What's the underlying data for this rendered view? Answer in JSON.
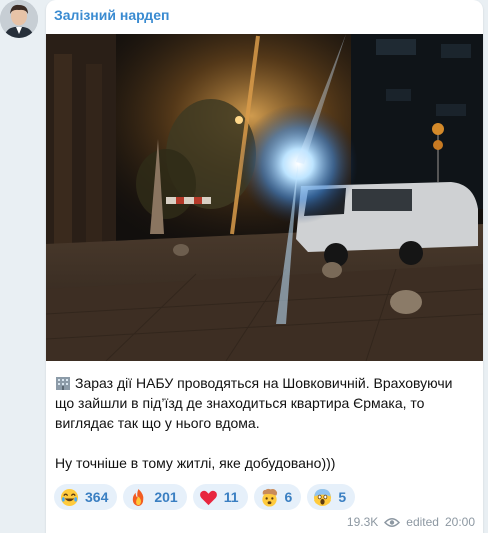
{
  "channel": {
    "name": "Залізний нардеп"
  },
  "message": {
    "emoji": "office-building",
    "paragraph1": "Зараз дії НАБУ проводяться на Шовковичній. Враховуючи що зайшли в під’їзд де знаходиться квартира Єрмака, то виглядає так що у нього вдома.",
    "paragraph2": "Ну точніше в тому житлі, яке добудовано)))"
  },
  "reactions": [
    {
      "icon": "laughing-emoji-icon",
      "count": "364"
    },
    {
      "icon": "fire-emoji-icon",
      "count": "201"
    },
    {
      "icon": "heart-emoji-icon",
      "count": "11"
    },
    {
      "icon": "exploding-head-emoji-icon",
      "count": "6"
    },
    {
      "icon": "screaming-emoji-icon",
      "count": "5"
    }
  ],
  "meta": {
    "views": "19.3K",
    "edited_label": "edited",
    "time": "20:00"
  },
  "colors": {
    "accent": "#3a8bd1",
    "reaction_bg": "#e6f0fa",
    "meta": "#8d98a2"
  }
}
